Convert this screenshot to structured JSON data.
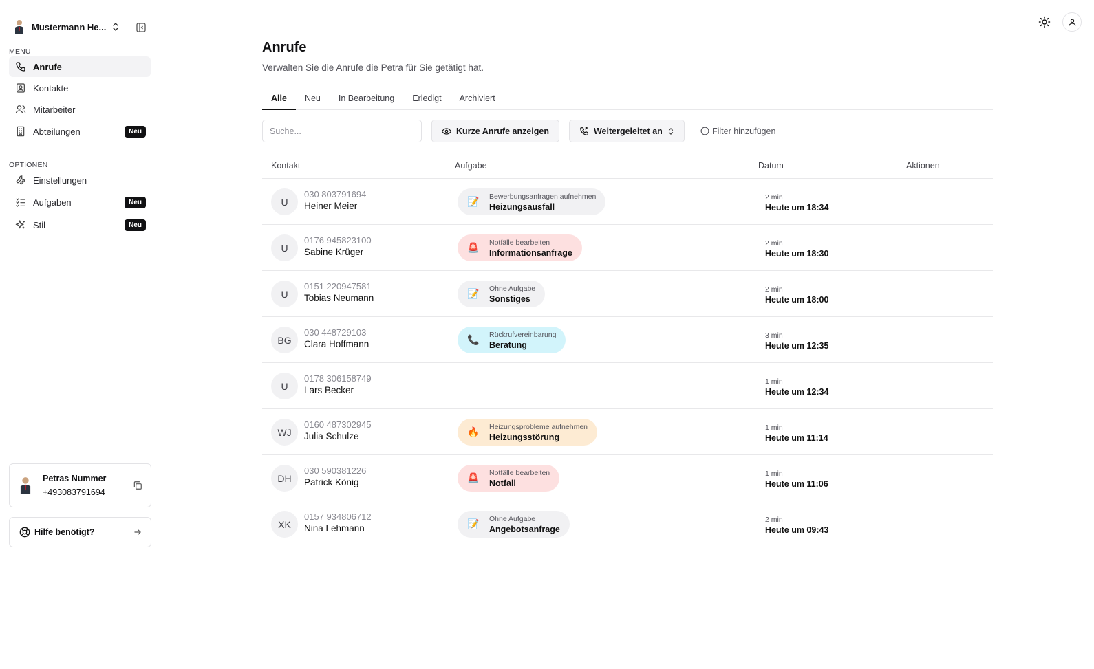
{
  "org": {
    "name": "Mustermann He..."
  },
  "sidebar": {
    "menu_label": "MENU",
    "options_label": "OPTIONEN",
    "menu_items": [
      {
        "label": "Anrufe",
        "icon": "phone-icon",
        "active": true,
        "badge": ""
      },
      {
        "label": "Kontakte",
        "icon": "contact-card-icon",
        "active": false,
        "badge": ""
      },
      {
        "label": "Mitarbeiter",
        "icon": "users-icon",
        "active": false,
        "badge": ""
      },
      {
        "label": "Abteilungen",
        "icon": "building-icon",
        "active": false,
        "badge": "Neu"
      }
    ],
    "option_items": [
      {
        "label": "Einstellungen",
        "icon": "wrench-icon",
        "badge": ""
      },
      {
        "label": "Aufgaben",
        "icon": "checklist-icon",
        "badge": "Neu"
      },
      {
        "label": "Stil",
        "icon": "sparkles-icon",
        "badge": "Neu"
      }
    ],
    "petra_card": {
      "title": "Petras Nummer",
      "number": "+493083791694"
    },
    "help": {
      "label": "Hilfe benötigt?"
    }
  },
  "page": {
    "title": "Anrufe",
    "subtitle": "Verwalten Sie die Anrufe die Petra für Sie getätigt hat."
  },
  "tabs": [
    "Alle",
    "Neu",
    "In Bearbeitung",
    "Erledigt",
    "Archiviert"
  ],
  "toolbar": {
    "search_placeholder": "Suche...",
    "short_calls_label": "Kurze Anrufe anzeigen",
    "forwarded_label": "Weitergeleitet an",
    "add_filter_label": "Filter hinzufügen"
  },
  "table": {
    "headers": {
      "contact": "Kontakt",
      "task": "Aufgabe",
      "date": "Datum",
      "actions": "Aktionen"
    },
    "rows": [
      {
        "initials": "U",
        "phone": "030 803791694",
        "name": "Heiner Meier",
        "task": {
          "emoji": "📝",
          "top": "Bewerbungsanfragen aufnehmen",
          "bottom": "Heizungsausfall",
          "color": "#f1f1f3"
        },
        "duration": "2 min",
        "when": "Heute um 18:34"
      },
      {
        "initials": "U",
        "phone": "0176 945823100",
        "name": "Sabine Krüger",
        "task": {
          "emoji": "🚨",
          "top": "Notfälle bearbeiten",
          "bottom": "Informationsanfrage",
          "color": "#fde0e0"
        },
        "duration": "2 min",
        "when": "Heute um 18:30"
      },
      {
        "initials": "U",
        "phone": "0151 220947581",
        "name": "Tobias Neumann",
        "task": {
          "emoji": "📝",
          "top": "Ohne Aufgabe",
          "bottom": "Sonstiges",
          "color": "#f1f1f3"
        },
        "duration": "2 min",
        "when": "Heute um 18:00"
      },
      {
        "initials": "BG",
        "phone": "030 448729103",
        "name": "Clara Hoffmann",
        "task": {
          "emoji": "📞",
          "top": "Rückrufvereinbarung",
          "bottom": "Beratung",
          "color": "#d2f4fb"
        },
        "duration": "3 min",
        "when": "Heute um 12:35"
      },
      {
        "initials": "U",
        "phone": "0178 306158749",
        "name": "Lars Becker",
        "task": null,
        "duration": "1 min",
        "when": "Heute um 12:34"
      },
      {
        "initials": "WJ",
        "phone": "0160 487302945",
        "name": "Julia Schulze",
        "task": {
          "emoji": "🔥",
          "top": "Heizungsprobleme aufnehmen",
          "bottom": "Heizungsstörung",
          "color": "#fdebd3"
        },
        "duration": "1 min",
        "when": "Heute um 11:14"
      },
      {
        "initials": "DH",
        "phone": "030 590381226",
        "name": "Patrick König",
        "task": {
          "emoji": "🚨",
          "top": "Notfälle bearbeiten",
          "bottom": "Notfall",
          "color": "#fde0e0"
        },
        "duration": "1 min",
        "when": "Heute um 11:06"
      },
      {
        "initials": "XK",
        "phone": "0157 934806712",
        "name": "Nina Lehmann",
        "task": {
          "emoji": "📝",
          "top": "Ohne Aufgabe",
          "bottom": "Angebotsanfrage",
          "color": "#f1f1f3"
        },
        "duration": "2 min",
        "when": "Heute um 09:43"
      }
    ]
  }
}
